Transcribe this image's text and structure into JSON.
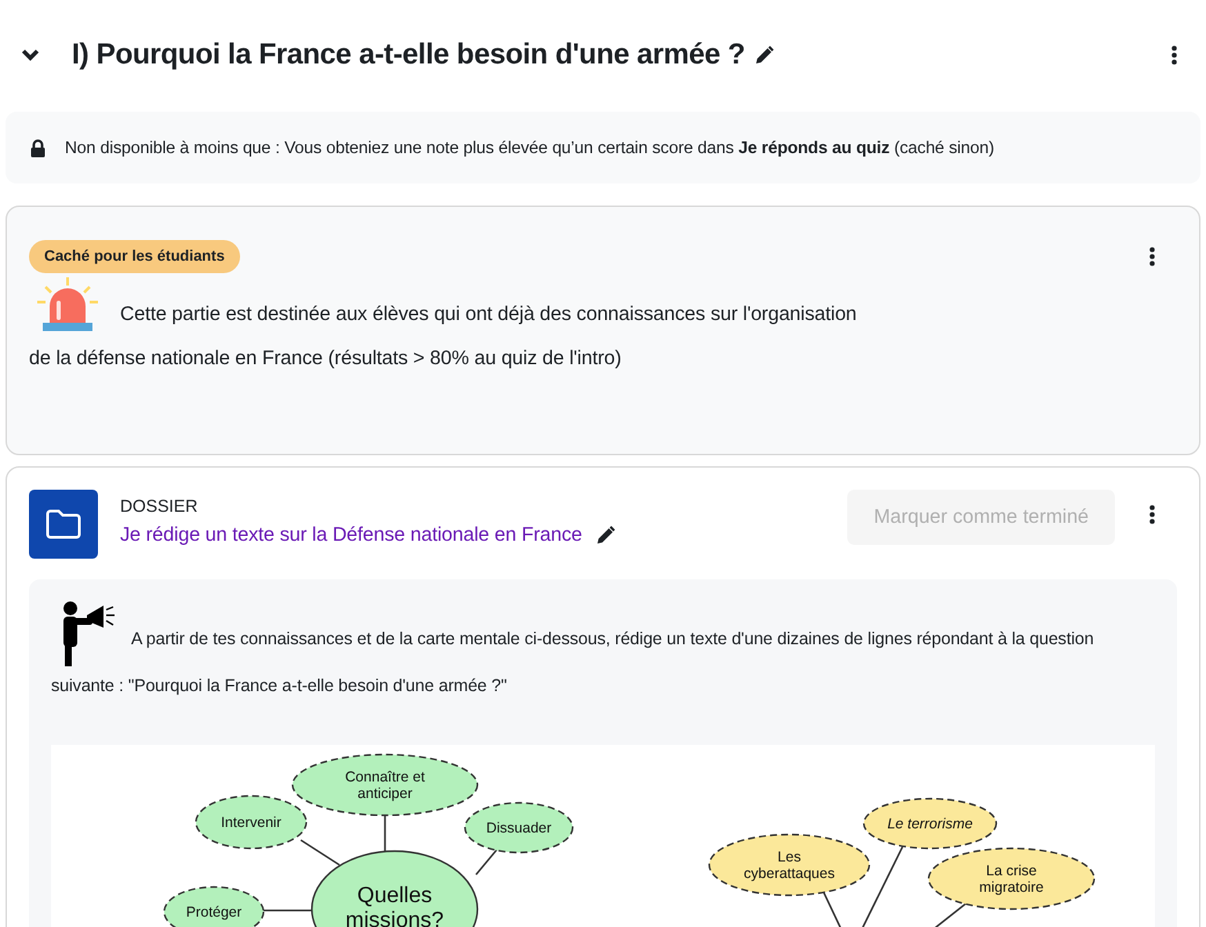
{
  "section": {
    "title": "I) Pourquoi la France a-t-elle besoin d'une armée ?",
    "expanded": true
  },
  "restriction": {
    "text": "Non disponible à moins que : Vous obteniez une note plus élevée qu’un certain score dans **Je réponds au quiz** (caché sinon)"
  },
  "hidden_card": {
    "badge": "Caché pour les étudiants",
    "line_1": "Cette partie est destinée aux élèves qui ont déjà des connaissances sur l'organisation",
    "line_2": "de la défense nationale en France (résultats > 80% au quiz de l'intro)"
  },
  "activity": {
    "type": "DOSSIER",
    "title": "Je rédige un texte sur la Défense nationale en France",
    "completion_button": "Marquer comme terminé",
    "completion_disabled": true,
    "intro_line_1": "A partir de tes connaissances et de la carte mentale ci-dessous, rédige un texte d'une dizaines de lignes répondant à la question",
    "intro_line_2": "suivante : \"Pourquoi la France a-t-elle besoin d'une armée ?\"",
    "mind_map": {
      "nodes": [
        {
          "text": "Connaître et\nanticiper",
          "color": "#b3f0bb"
        },
        {
          "text": "Intervenir",
          "color": "#b3f0bb"
        },
        {
          "text": "Dissuader",
          "color": "#b3f0bb"
        },
        {
          "text": "Protéger",
          "color": "#b3f0bb"
        },
        {
          "text": "Quelles\nmissions?",
          "color": "#b3f0bb"
        },
        {
          "text": "Les\ncyberattaques",
          "color": "#fbe89a"
        },
        {
          "text": "Le terrorisme",
          "color": "#fbe89a"
        },
        {
          "text": "La crise\nmigratoire",
          "color": "#fbe89a"
        }
      ]
    }
  }
}
